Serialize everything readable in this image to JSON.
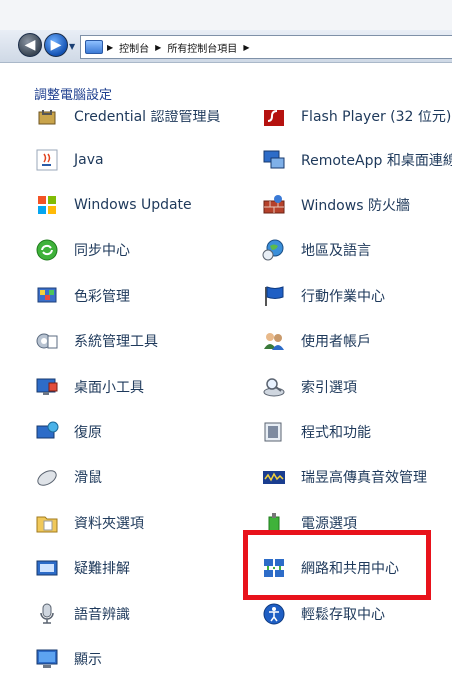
{
  "address_bar": {
    "crumbs": [
      "控制台",
      "所有控制台項目"
    ]
  },
  "header": {
    "title": "調整電腦設定"
  },
  "left_items": [
    {
      "label": "Credential 認證管理員",
      "icon": "credential-icon"
    },
    {
      "label": "Java",
      "icon": "java-icon"
    },
    {
      "label": "Windows Update",
      "icon": "windows-update-icon"
    },
    {
      "label": "同步中心",
      "icon": "sync-center-icon"
    },
    {
      "label": "色彩管理",
      "icon": "color-management-icon"
    },
    {
      "label": "系統管理工具",
      "icon": "admin-tools-icon"
    },
    {
      "label": "桌面小工具",
      "icon": "desktop-gadgets-icon"
    },
    {
      "label": "復原",
      "icon": "recovery-icon"
    },
    {
      "label": "滑鼠",
      "icon": "mouse-icon"
    },
    {
      "label": "資料夾選項",
      "icon": "folder-options-icon"
    },
    {
      "label": "疑難排解",
      "icon": "troubleshooting-icon"
    },
    {
      "label": "語音辨識",
      "icon": "speech-recognition-icon"
    },
    {
      "label": "顯示",
      "icon": "display-icon"
    }
  ],
  "right_items": [
    {
      "label": "Flash Player (32 位元)",
      "icon": "flash-player-icon"
    },
    {
      "label": "RemoteApp 和桌面連線",
      "icon": "remoteapp-icon"
    },
    {
      "label": "Windows 防火牆",
      "icon": "firewall-icon"
    },
    {
      "label": "地區及語言",
      "icon": "region-language-icon"
    },
    {
      "label": "行動作業中心",
      "icon": "action-center-icon"
    },
    {
      "label": "使用者帳戶",
      "icon": "user-accounts-icon"
    },
    {
      "label": "索引選項",
      "icon": "indexing-options-icon"
    },
    {
      "label": "程式和功能",
      "icon": "programs-features-icon"
    },
    {
      "label": "瑞昱高傳真音效管理",
      "icon": "realtek-audio-icon"
    },
    {
      "label": "電源選項",
      "icon": "power-options-icon"
    },
    {
      "label": "網路和共用中心",
      "icon": "network-sharing-icon"
    },
    {
      "label": "輕鬆存取中心",
      "icon": "ease-of-access-icon"
    }
  ],
  "accent_colors": {
    "link_text": "#1e395b",
    "header_text": "#1e3f8f",
    "highlight_box": "#e8121b"
  }
}
